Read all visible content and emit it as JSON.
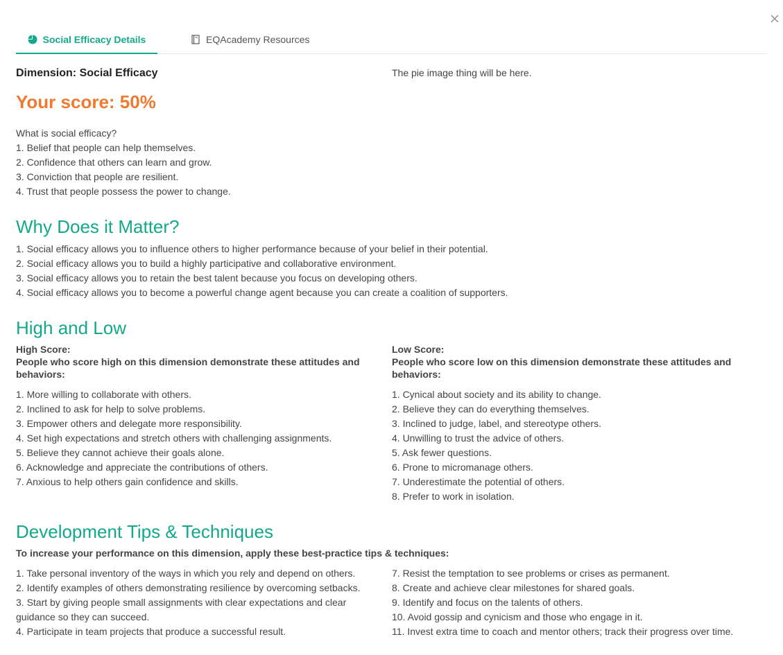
{
  "close_icon": "close-icon",
  "tabs": [
    {
      "label": "Social Efficacy Details",
      "icon": "pie-chart-icon",
      "active": true
    },
    {
      "label": "EQAcademy Resources",
      "icon": "book-icon",
      "active": false
    }
  ],
  "colors": {
    "accent": "#13a88a",
    "score": "#ef7a2f"
  },
  "dimension_title": "Dimension: Social Efficacy",
  "pie_placeholder": "The pie image thing will be here.",
  "score_text": "Your score: 50%",
  "what_is": {
    "question": "What is social efficacy?",
    "items": [
      "1. Belief that people can help themselves.",
      "2. Confidence that others can learn and grow.",
      "3. Conviction that people are resilient.",
      "4. Trust that people possess the power to change."
    ]
  },
  "why_matter": {
    "heading": "Why Does it Matter?",
    "items": [
      "1. Social efficacy allows you to influence others to higher performance because of your belief in their potential.",
      "2. Social efficacy allows you to build a highly participative and collaborative environment.",
      "3. Social efficacy allows you to retain the best talent because you focus on developing others.",
      "4. Social efficacy allows you to become a powerful change agent because you can create a coalition of supporters."
    ]
  },
  "high_low": {
    "heading": "High and Low",
    "high": {
      "label": "High Score:",
      "description": "People who score high on this dimension demonstrate these attitudes and behaviors:",
      "items": [
        "1. More willing to collaborate with others.",
        "2. Inclined to ask for help to solve problems.",
        "3. Empower others and delegate more responsibility.",
        "4. Set high expectations and stretch others with challenging assignments.",
        "5. Believe they cannot achieve their goals alone.",
        "6. Acknowledge and appreciate the contributions of others.",
        "7. Anxious to help others gain confidence and skills."
      ]
    },
    "low": {
      "label": "Low Score:",
      "description": "People who score low on this dimension demonstrate these attitudes and behaviors:",
      "items": [
        "1. Cynical about society and its ability to change.",
        "2. Believe they can do everything themselves.",
        "3. Inclined to judge, label, and stereotype others.",
        "4. Unwilling to trust the advice of others.",
        "5. Ask fewer questions.",
        "6. Prone to micromanage others.",
        "7. Underestimate the potential of others.",
        "8. Prefer to work in isolation."
      ]
    }
  },
  "tips": {
    "heading": "Development Tips & Techniques",
    "intro": "To increase your performance on this dimension, apply these best-practice tips & techniques:",
    "left": [
      "1. Take personal inventory of the ways in which you rely and depend on others.",
      "2. Identify examples of others demonstrating resilience by overcoming setbacks.",
      "3. Start by giving people small assignments with clear expectations and clear guidance so they can succeed.",
      "4. Participate in team projects that produce a successful result."
    ],
    "right": [
      "7. Resist the temptation to see problems or crises as permanent.",
      "8. Create and achieve clear milestones for shared goals.",
      "9. Identify and focus on the talents of others.",
      "10. Avoid gossip and cynicism and those who engage in it.",
      "11. Invest extra time to coach and mentor others; track their progress over time."
    ]
  }
}
